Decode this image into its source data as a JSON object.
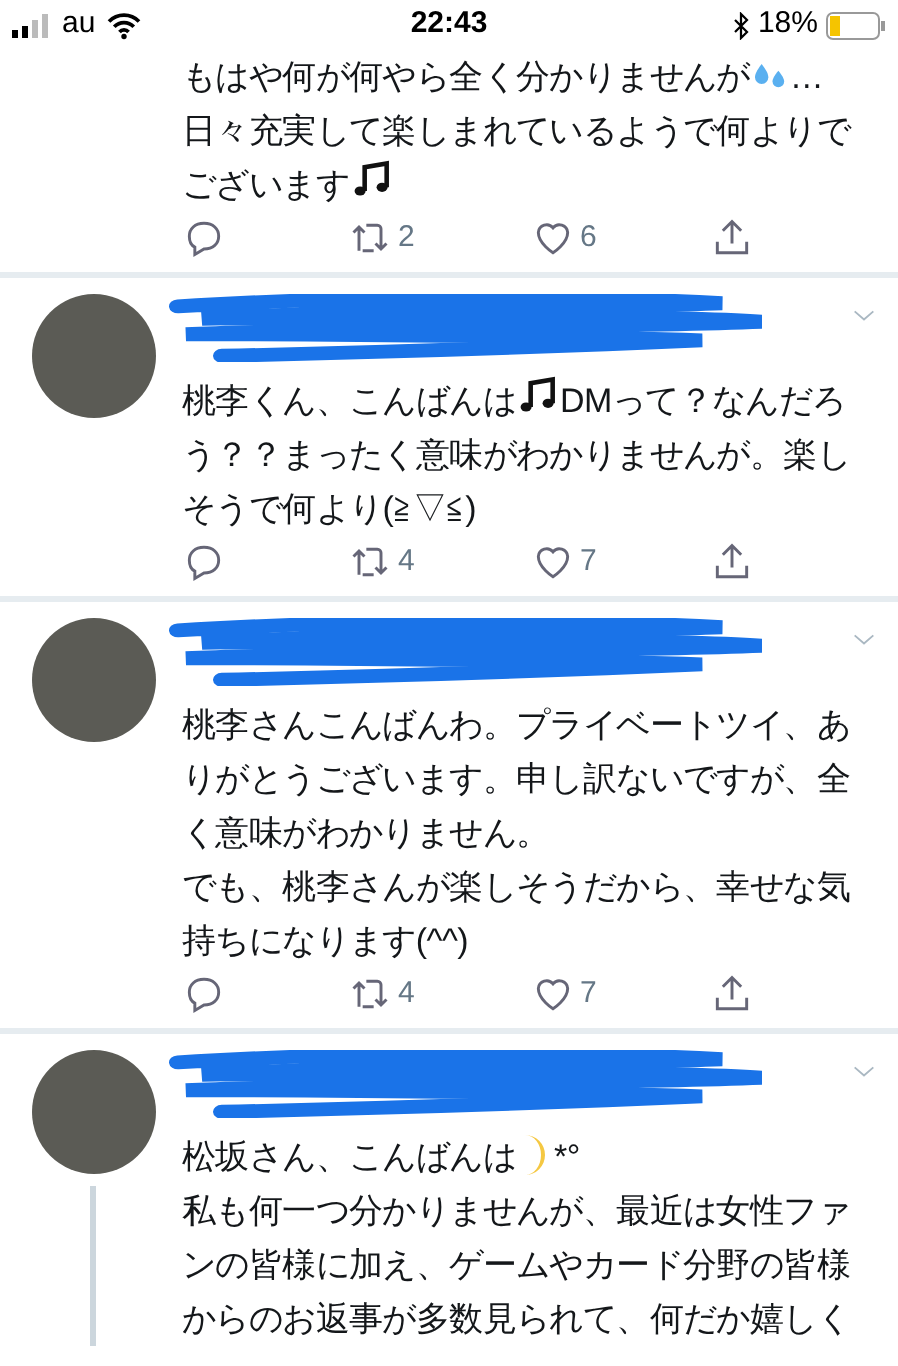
{
  "status_bar": {
    "carrier": "au",
    "time": "22:43",
    "battery": "18%"
  },
  "tweets": [
    {
      "avatar": false,
      "redacted_header": false,
      "thread_line": false,
      "body": [
        [
          {
            "kind": "text",
            "text": "もはや何が何やら全く分かりませんが"
          },
          {
            "kind": "sweat_emoji"
          },
          {
            "kind": "text",
            "text": "…"
          }
        ],
        [
          {
            "kind": "text",
            "text": "日々充実して楽しまれているようで何よりでございます"
          },
          {
            "kind": "note_emoji"
          }
        ]
      ],
      "actions": {
        "retweets": "2",
        "likes": "6"
      }
    },
    {
      "avatar": true,
      "redacted_header": true,
      "thread_line": false,
      "body": [
        [
          {
            "kind": "text",
            "text": "桃李くん、こんばんは"
          },
          {
            "kind": "note_emoji"
          },
          {
            "kind": "text",
            "text": "DMって？なんだろう？？まったく意味がわかりませんが。楽しそうで何より(≧▽≦)"
          }
        ]
      ],
      "actions": {
        "retweets": "4",
        "likes": "7"
      }
    },
    {
      "avatar": true,
      "redacted_header": true,
      "thread_line": false,
      "body": [
        [
          {
            "kind": "text",
            "text": "桃李さんこんばんわ。プライベートツイ、ありがとうございます。申し訳ないですが、全く意味がわかりません。"
          }
        ],
        [
          {
            "kind": "text",
            "text": "でも、桃李さんが楽しそうだから、幸せな気持ちになります(^^)"
          }
        ]
      ],
      "actions": {
        "retweets": "4",
        "likes": "7"
      }
    },
    {
      "avatar": true,
      "redacted_header": true,
      "thread_line": true,
      "body": [
        [
          {
            "kind": "text",
            "text": "松坂さん、こんばんは"
          },
          {
            "kind": "moon_emoji"
          },
          {
            "kind": "text",
            "text": "*°"
          }
        ],
        [
          {
            "kind": "text",
            "text": "私も何一つ分かりませんが、最近は女性ファンの皆様に加え、ゲームやカード分野の皆様からのお返事が多数見られて、何だか嬉しく"
          }
        ]
      ]
    }
  ]
}
